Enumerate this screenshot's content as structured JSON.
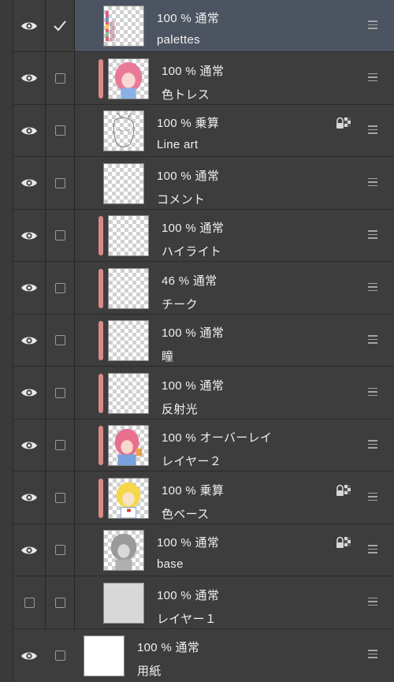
{
  "layers": [
    {
      "name": "palettes",
      "opacity": "100 %",
      "blend": "通常",
      "visible": true,
      "checked": true,
      "selected": true,
      "clipped": false,
      "locked": false,
      "thumb": "palettes"
    },
    {
      "name": "色トレス",
      "opacity": "100 %",
      "blend": "通常",
      "visible": true,
      "checked": false,
      "selected": false,
      "clipped": true,
      "locked": false,
      "thumb": "girl-pink"
    },
    {
      "name": "Line art",
      "opacity": "100 %",
      "blend": "乗算",
      "visible": true,
      "checked": false,
      "selected": false,
      "clipped": false,
      "locked": true,
      "thumb": "sketch"
    },
    {
      "name": "コメント",
      "opacity": "100 %",
      "blend": "通常",
      "visible": true,
      "checked": false,
      "selected": false,
      "clipped": false,
      "locked": false,
      "thumb": "empty"
    },
    {
      "name": "ハイライト",
      "opacity": "100 %",
      "blend": "通常",
      "visible": true,
      "checked": false,
      "selected": false,
      "clipped": true,
      "locked": false,
      "thumb": "empty"
    },
    {
      "name": "チーク",
      "opacity": "46 %",
      "blend": "通常",
      "visible": true,
      "checked": false,
      "selected": false,
      "clipped": true,
      "locked": false,
      "thumb": "empty"
    },
    {
      "name": "瞳",
      "opacity": "100 %",
      "blend": "通常",
      "visible": true,
      "checked": false,
      "selected": false,
      "clipped": true,
      "locked": false,
      "thumb": "empty"
    },
    {
      "name": "反射光",
      "opacity": "100 %",
      "blend": "通常",
      "visible": true,
      "checked": false,
      "selected": false,
      "clipped": true,
      "locked": false,
      "thumb": "faint"
    },
    {
      "name": "レイヤー２",
      "opacity": "100 %",
      "blend": "オーバーレイ",
      "visible": true,
      "checked": false,
      "selected": false,
      "clipped": true,
      "locked": false,
      "thumb": "girl-color"
    },
    {
      "name": "色ベース",
      "opacity": "100 %",
      "blend": "乗算",
      "visible": true,
      "checked": false,
      "selected": false,
      "clipped": true,
      "locked": true,
      "thumb": "girl-yellow"
    },
    {
      "name": "base",
      "opacity": "100 %",
      "blend": "通常",
      "visible": true,
      "checked": false,
      "selected": false,
      "clipped": false,
      "locked": true,
      "thumb": "gray-girl"
    },
    {
      "name": "レイヤー１",
      "opacity": "100 %",
      "blend": "通常",
      "visible": false,
      "checked": false,
      "selected": false,
      "clipped": false,
      "locked": false,
      "thumb": "gray-fill"
    }
  ],
  "paper": {
    "name": "用紙",
    "opacity": "100 %",
    "blend": "通常",
    "visible": true,
    "checked": false
  },
  "colors": {
    "clip_bar": "#d98a87",
    "selected_row": "#4d5461",
    "panel_bg": "#3d3d3d",
    "text": "#f0f0f0"
  },
  "icons": {
    "visibility": "eye-icon",
    "lock": "lock-alpha-icon",
    "drag": "drag-handle-icon",
    "check": "check-icon"
  }
}
